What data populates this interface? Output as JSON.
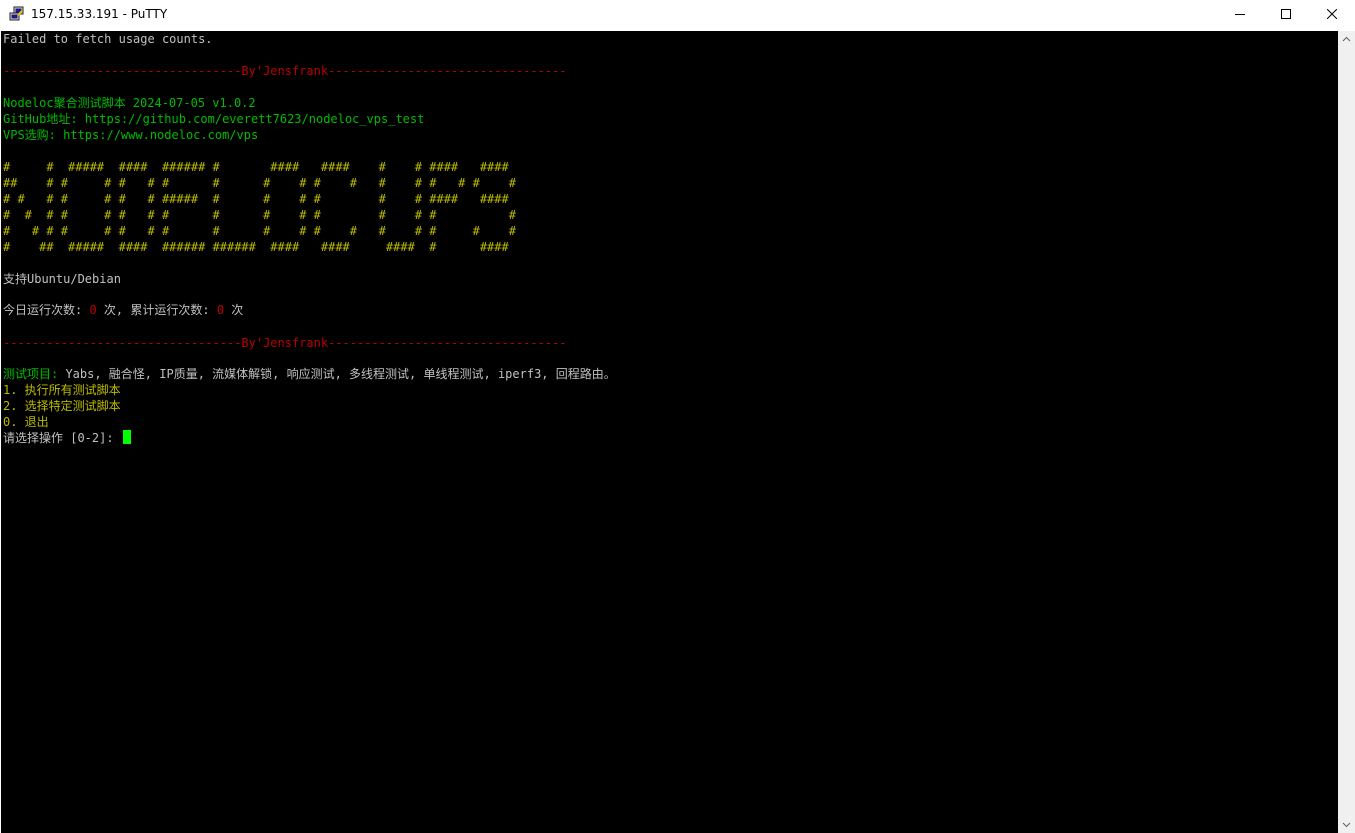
{
  "window": {
    "title": "157.15.33.191 - PuTTY"
  },
  "titlebar_icons": {
    "app": "putty-icon",
    "minimize": "minimize-icon",
    "maximize": "maximize-icon",
    "close": "close-icon"
  },
  "terminal": {
    "lines": [
      "Failed to fetch usage counts.",
      "",
      "---------------------------------By'Jensfrank---------------------------------",
      "",
      "Nodeloc聚合测试脚本 2024-07-05 v1.0.2",
      "GitHub地址: https://github.com/everett7623/nodeloc_vps_test",
      "VPS选购: https://www.nodeloc.com/vps",
      "",
      "#     #  #####  ####  ###### #       ####   ####    #    # ####   ####",
      "##    # #     # #   # #      #      #    # #    #   #    # #   # #    #",
      "# #   # #     # #   # #####  #      #    # #        #    # ####   ####",
      "#  #  # #     # #   # #      #      #    # #        #    # #          #",
      "#   # # #     # #   # #      #      #    # #    #   #    # #     #    #",
      "#    ##  #####  ####  ###### ######  ####   ####     ####  #      ####",
      "",
      "支持Ubuntu/Debian",
      "",
      "今日运行次数: 0 次, 累计运行次数: 0 次",
      "",
      "---------------------------------By'Jensfrank---------------------------------",
      "",
      "测试项目: Yabs, 融合怪, IP质量, 流媒体解锁, 响应测试, 多线程测试, 单线程测试, iperf3, 回程路由。",
      "1. 执行所有测试脚本",
      "2. 选择特定测试脚本",
      "0. 退出",
      "请选择操作 [0-2]: "
    ],
    "usage": {
      "prefix": "今日运行次数: ",
      "today": "0",
      "middle": " 次, 累计运行次数: ",
      "total": "0",
      "suffix": " 次"
    },
    "tests": {
      "label": "测试项目:",
      "items": " Yabs, 融合怪, IP质量, 流媒体解锁, 响应测试, 多线程测试, 单线程测试, iperf3, 回程路由。"
    },
    "colors": {
      "foreground": "#c0c0c0",
      "red": "#bb0000",
      "green": "#00bb00",
      "yellow": "#bbbb00",
      "background": "#000000",
      "cursor": "#00ff00"
    }
  }
}
